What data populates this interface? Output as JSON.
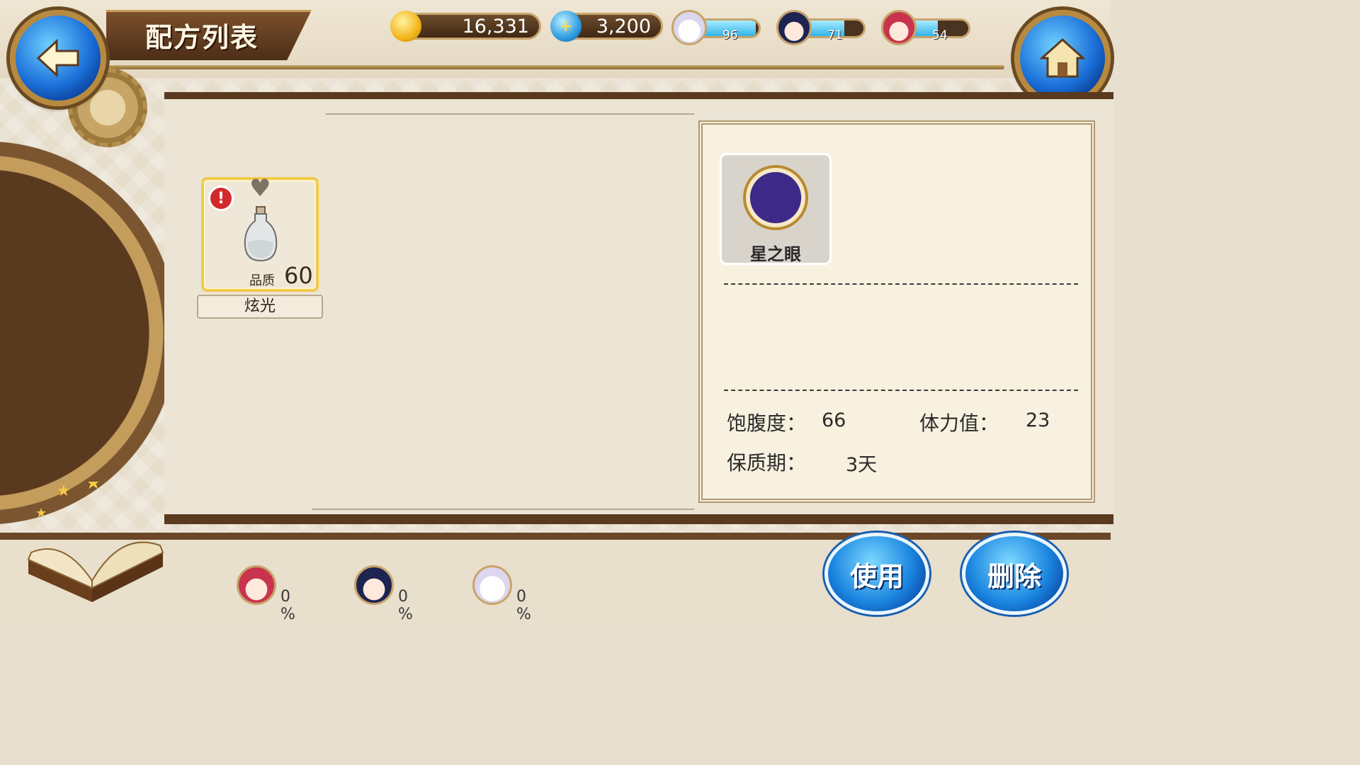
{
  "header": {
    "title": "配方列表",
    "back_icon": "back-arrow-icon",
    "home_icon": "home-icon"
  },
  "currency": {
    "gold": "16,331",
    "gems": "3,200"
  },
  "characters": [
    {
      "avatar": "white-hair-girl",
      "value": "96",
      "level": 0.96
    },
    {
      "avatar": "navy-hair-girl",
      "value": "71",
      "level": 0.71
    },
    {
      "avatar": "red-hair-girl",
      "value": "54",
      "level": 0.54
    }
  ],
  "recipe": {
    "quality_label": "品质",
    "quality_value": "60",
    "name": "炫光"
  },
  "detail": {
    "ingredient_name": "星之眼",
    "satiety_label": "饱腹度：",
    "satiety_value": "66",
    "stamina_label": "体力值：",
    "stamina_value": "23",
    "shelf_life_label": "保质期：",
    "shelf_life_value": "3天"
  },
  "shares": [
    {
      "avatar": "red-hair-girl",
      "percent": "0 %"
    },
    {
      "avatar": "navy-hair-girl",
      "percent": "0 %"
    },
    {
      "avatar": "white-hair-girl",
      "percent": "0 %"
    }
  ],
  "actions": {
    "use_label": "使用",
    "delete_label": "删除"
  },
  "colors": {
    "frame_brown": "#5a3a1e",
    "accent_gold": "#c8a46a",
    "button_blue": "#1b86e0",
    "gauge_fill": "#33b3e8",
    "alert_red": "#d22a2a",
    "card_border": "#f2c94c"
  }
}
